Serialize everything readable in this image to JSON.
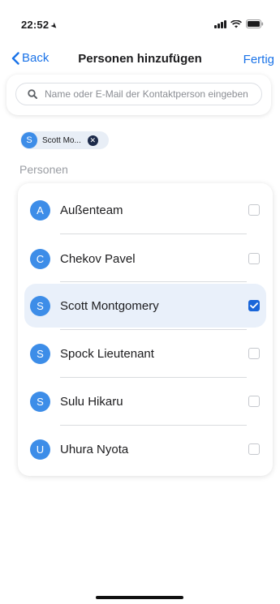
{
  "status_bar": {
    "time": "22:52"
  },
  "nav": {
    "back_label": "Back",
    "title": "Personen hinzufügen",
    "done_label": "Fertig"
  },
  "search": {
    "placeholder": "Name oder E-Mail der Kontaktperson eingeben",
    "value": ""
  },
  "selected_chips": [
    {
      "initial": "S",
      "label": "Scott Mo..."
    }
  ],
  "section": {
    "title": "Personen"
  },
  "people": [
    {
      "initial": "A",
      "name": "Außenteam",
      "checked": false
    },
    {
      "initial": "C",
      "name": "Chekov Pavel",
      "checked": false
    },
    {
      "initial": "S",
      "name": "Scott Montgomery",
      "checked": true
    },
    {
      "initial": "S",
      "name": "Spock Lieutenant",
      "checked": false
    },
    {
      "initial": "S",
      "name": "Sulu Hikaru",
      "checked": false
    },
    {
      "initial": "U",
      "name": "Uhura Nyota",
      "checked": false
    }
  ],
  "colors": {
    "accent": "#1a73e8",
    "avatar": "#3d8de8",
    "selected_row": "#e9f0fa",
    "checkbox_checked": "#1a66d9"
  }
}
